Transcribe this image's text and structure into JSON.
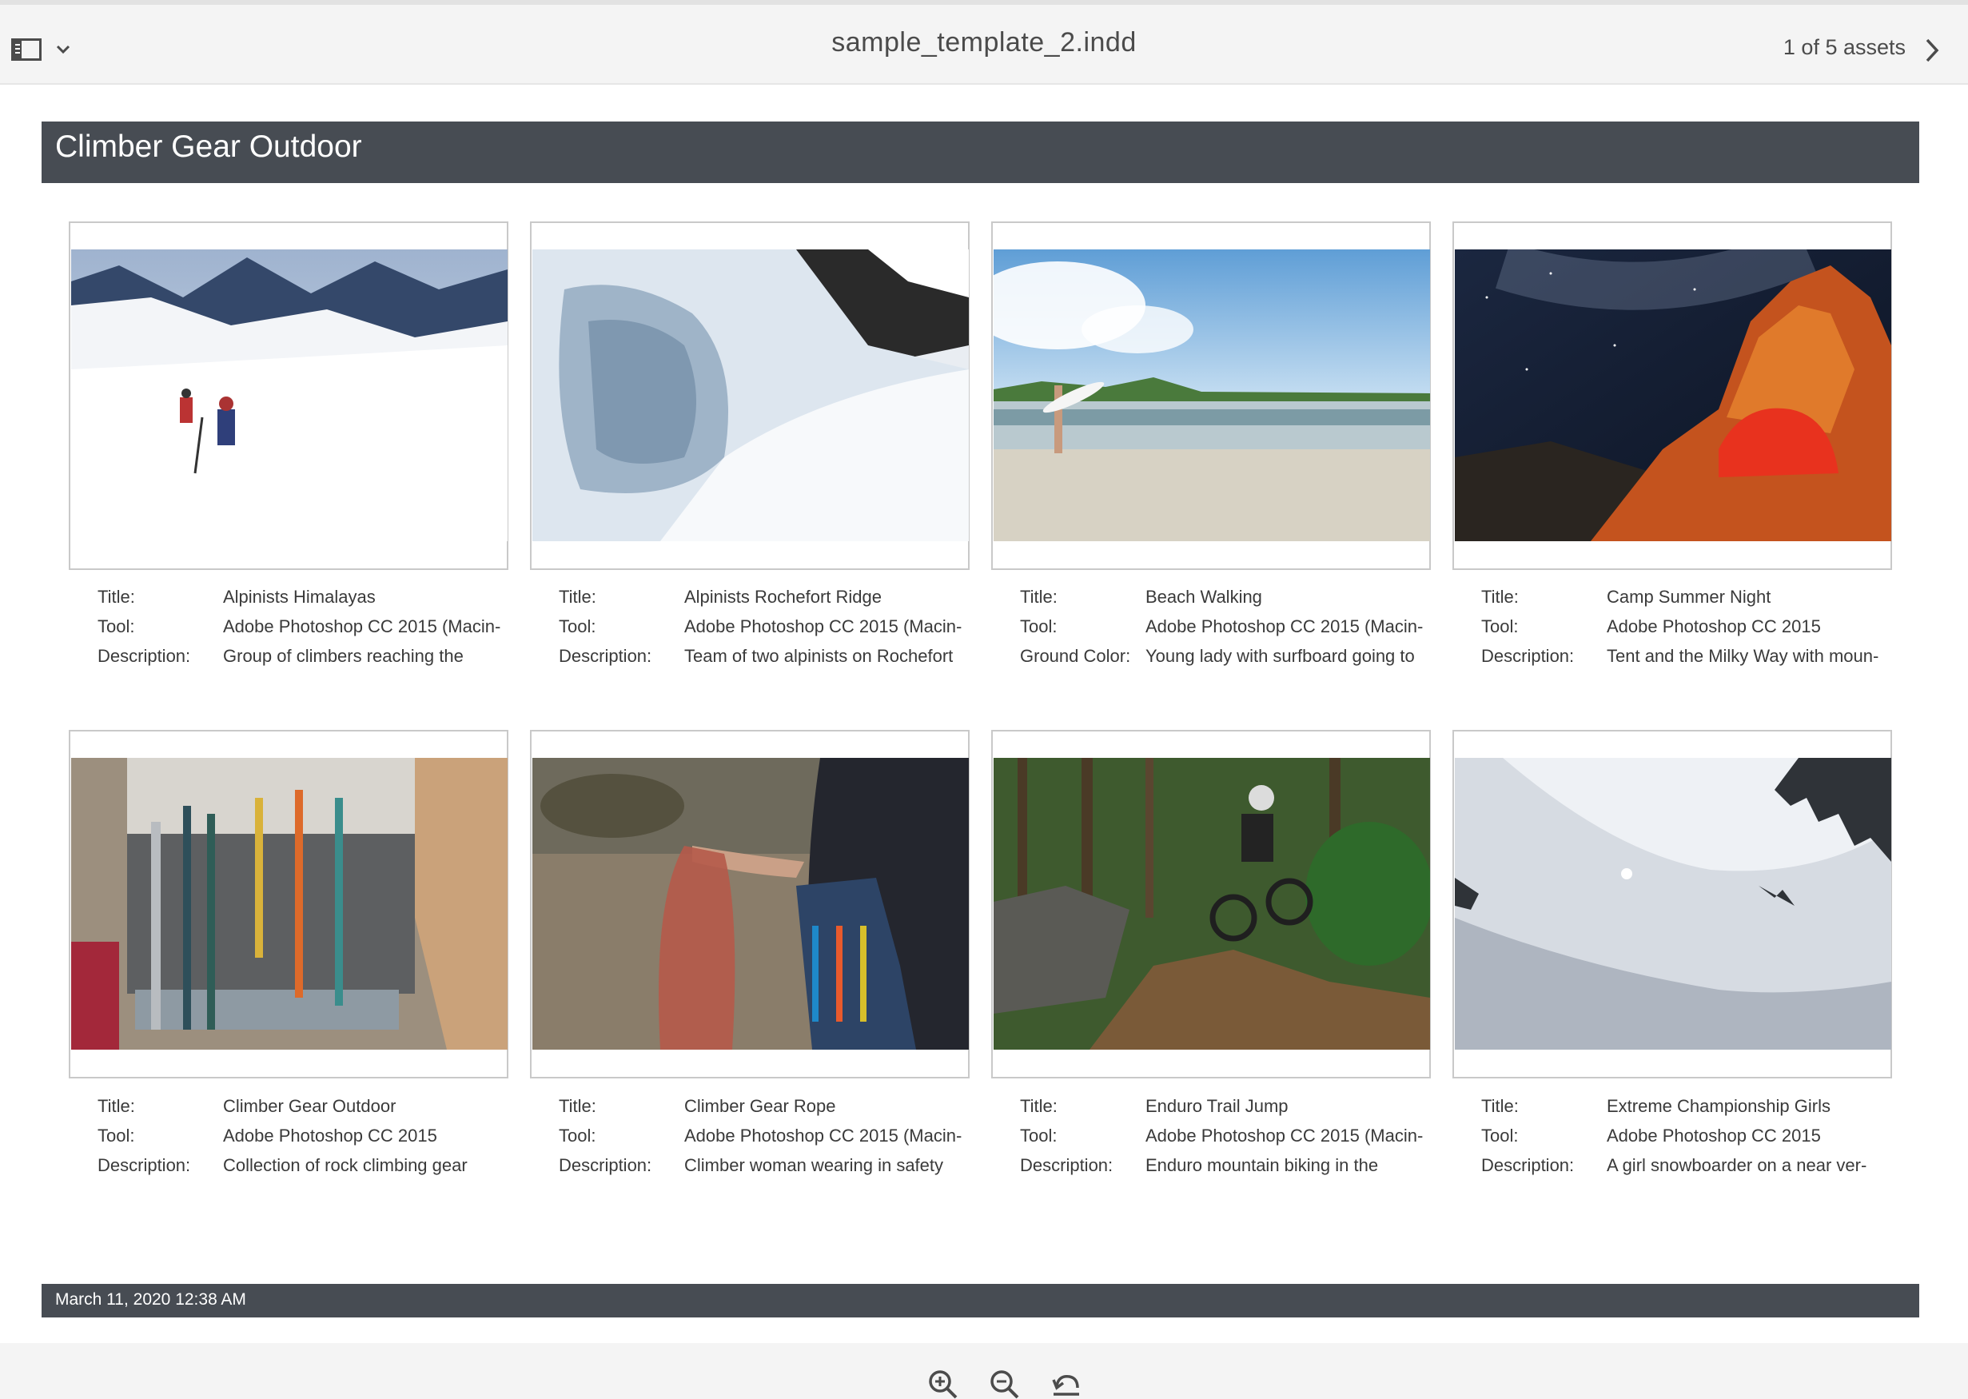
{
  "toolbar": {
    "file_name": "sample_template_2.indd",
    "asset_count": "1 of 5 assets",
    "icons": [
      "rail-toggle-icon",
      "chevron-down-icon",
      "chevron-right-icon"
    ]
  },
  "page": {
    "title": "Climber Gear Outdoor",
    "date": "March 11, 2020 12:38 AM",
    "header_color": "#474c53"
  },
  "assets": [
    {
      "image": "snowy mountain climbers",
      "rows": [
        {
          "label": "Title:",
          "value": "Alpinists Himalayas"
        },
        {
          "label": "Tool:",
          "value": "Adobe Photoshop CC 2015 (Macin-"
        },
        {
          "label": "Description:",
          "value": "Group of climbers reaching the"
        }
      ]
    },
    {
      "image": "snow ridge with crevasse",
      "rows": [
        {
          "label": "Title:",
          "value": "Alpinists Rochefort Ridge"
        },
        {
          "label": "Tool:",
          "value": "Adobe Photoshop CC 2015 (Macin-"
        },
        {
          "label": "Description:",
          "value": "Team of two alpinists on Rochefort"
        }
      ]
    },
    {
      "image": "beach with surfboard",
      "rows": [
        {
          "label": "Title:",
          "value": "Beach Walking"
        },
        {
          "label": "Tool:",
          "value": "Adobe Photoshop CC 2015 (Macin-"
        },
        {
          "label": "Ground Color:",
          "value": "Young lady with surfboard going to"
        }
      ]
    },
    {
      "image": "tent under milky way",
      "rows": [
        {
          "label": "Title:",
          "value": "Camp Summer Night"
        },
        {
          "label": "Tool:",
          "value": "Adobe Photoshop CC 2015"
        },
        {
          "label": "Description:",
          "value": "Tent and the Milky Way with moun-"
        }
      ]
    },
    {
      "image": "climbing gear carabiners",
      "rows": [
        {
          "label": "Title:",
          "value": "Climber Gear Outdoor"
        },
        {
          "label": "Tool:",
          "value": "Adobe Photoshop CC 2015"
        },
        {
          "label": "Description:",
          "value": "Collection of rock climbing gear"
        }
      ]
    },
    {
      "image": "climbing rope",
      "rows": [
        {
          "label": "Title:",
          "value": "Climber Gear Rope"
        },
        {
          "label": "Tool:",
          "value": "Adobe Photoshop CC 2015 (Macin-"
        },
        {
          "label": "Description:",
          "value": "Climber woman wearing in safety"
        }
      ]
    },
    {
      "image": "mountain bike jump in forest",
      "rows": [
        {
          "label": "Title:",
          "value": "Enduro Trail Jump"
        },
        {
          "label": "Tool:",
          "value": "Adobe Photoshop CC 2015 (Macin-"
        },
        {
          "label": "Description:",
          "value": "Enduro mountain biking in the"
        }
      ]
    },
    {
      "image": "snowboarder on snow slope",
      "rows": [
        {
          "label": "Title:",
          "value": "Extreme Championship Girls"
        },
        {
          "label": "Tool:",
          "value": "Adobe Photoshop CC 2015"
        },
        {
          "label": "Description:",
          "value": "A girl snowboarder on a near ver-"
        }
      ]
    }
  ],
  "controls": {
    "icons": [
      "zoom-in-icon",
      "zoom-out-icon",
      "reset-icon"
    ]
  }
}
